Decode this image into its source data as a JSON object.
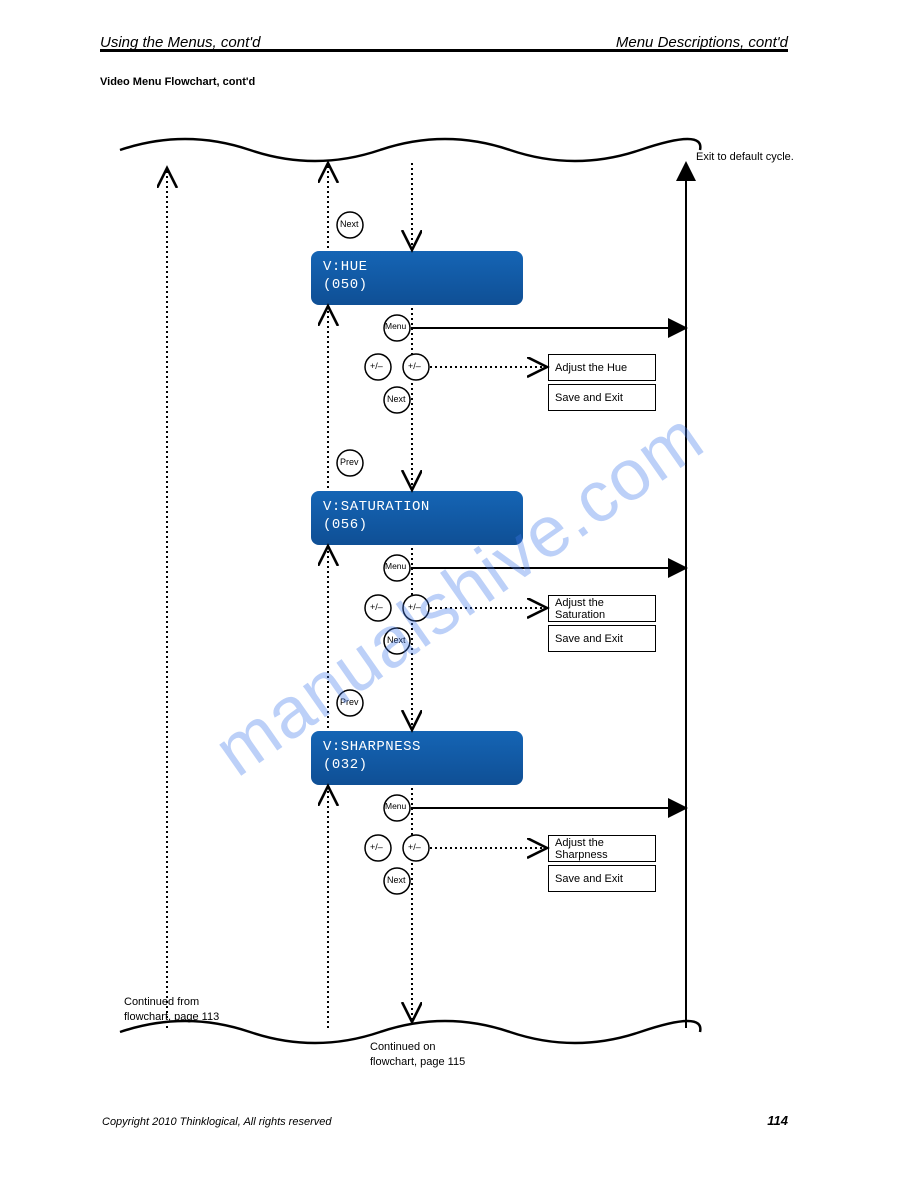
{
  "header": {
    "left": "Using the Menus, cont'd",
    "right": "Menu Descriptions, cont'd"
  },
  "section_title": "Video Menu Flowchart, cont'd",
  "watermark": "manualshive.com",
  "lcds": {
    "hue": {
      "line1": "V:HUE",
      "line2": "(050)"
    },
    "sat": {
      "line1": "V:SATURATION",
      "line2": "(056)"
    },
    "shp": {
      "line1": "V:SHARPNESS",
      "line2": "(032)"
    }
  },
  "actions": {
    "adjust_hue": {
      "line1": "Adjust the Hue",
      "line2": "Save and Exit"
    },
    "adjust_sat": {
      "line1": "Adjust the Saturation",
      "line2": "Save and Exit"
    },
    "adjust_shp": {
      "line1": "Adjust the Sharpness",
      "line2": "Save and Exit"
    }
  },
  "button_labels": {
    "menu": "Menu",
    "next": "Next",
    "prev": "Prev",
    "plus_minus": "+/–"
  },
  "exits": {
    "to_default": "Exit to default cycle.",
    "chart115": "Continued on\nflowchart, page 115",
    "chart113": "Continued from\nflowchart, page 113"
  },
  "footer": {
    "copyright": "Copyright 2010 Thinklogical, All rights reserved",
    "pagenum": "114"
  }
}
